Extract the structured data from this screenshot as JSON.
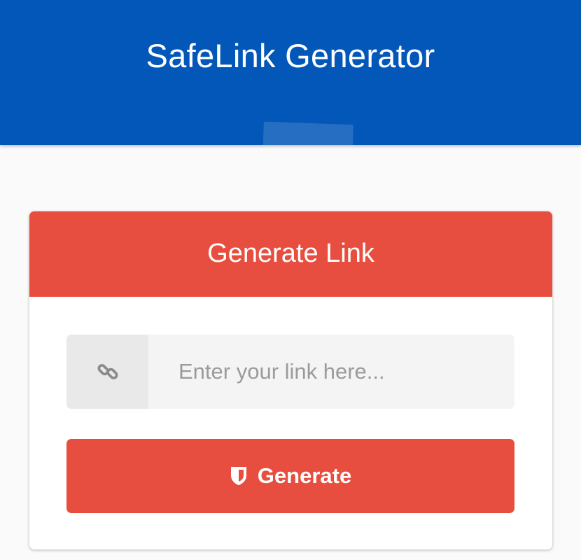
{
  "header": {
    "title": "SafeLink Generator",
    "background_color": "#0257b8"
  },
  "card": {
    "title": "Generate Link",
    "accent_color": "#e74e3f",
    "link_input": {
      "placeholder": "Enter your link here...",
      "value": "",
      "icon": "link-icon"
    },
    "generate_button": {
      "label": "Generate",
      "icon": "shield-icon"
    }
  }
}
